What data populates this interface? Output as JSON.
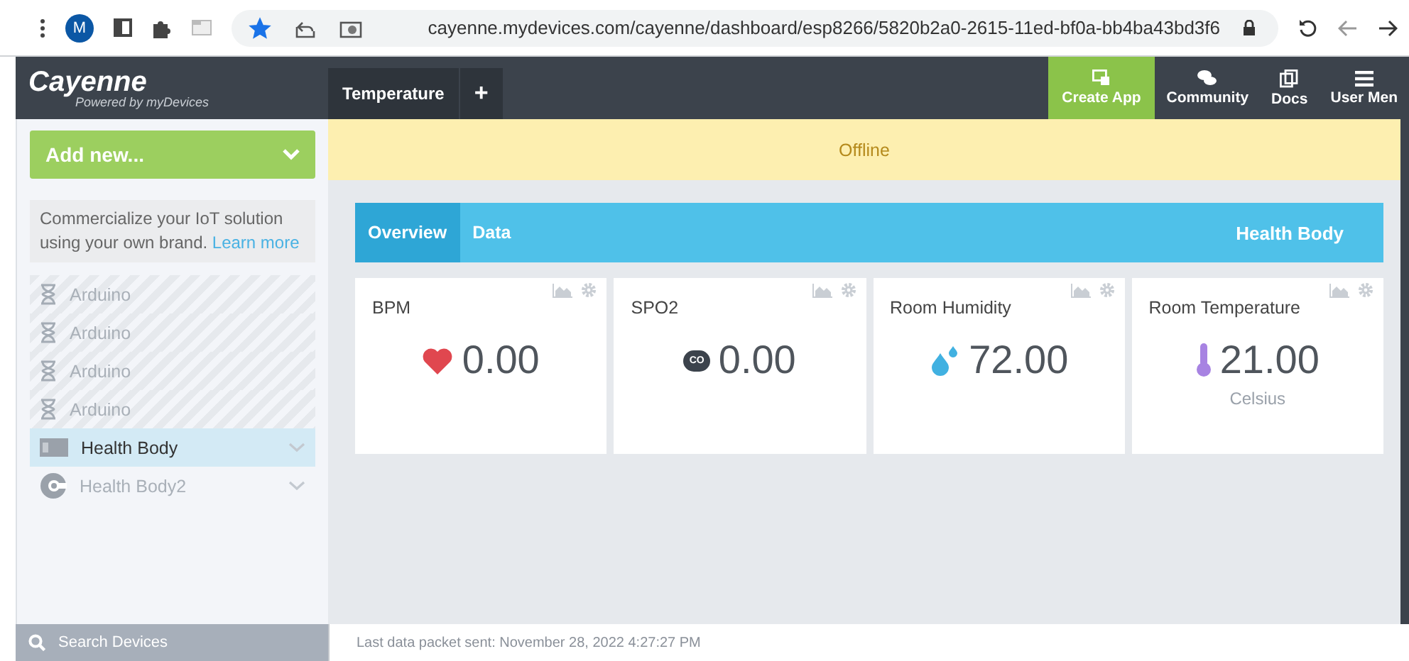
{
  "browser": {
    "avatar": "M",
    "bookmarked": true,
    "url": "cayenne.mydevices.com/cayenne/dashboard/esp8266/5820b2a0-2615-11ed-bf0a-bb4ba43bd3f6"
  },
  "header": {
    "logo": "Cayenne",
    "tagline": "Powered by myDevices",
    "tabs": [
      {
        "label": "Temperature",
        "selected": true
      }
    ],
    "add_tab": "+",
    "nav": [
      {
        "label": "Create App",
        "kind": "create",
        "selected": true
      },
      {
        "label": "Community",
        "kind": "community",
        "selected": false
      },
      {
        "label": "Docs",
        "kind": "docs",
        "selected": false
      },
      {
        "label": "User Men",
        "kind": "menu",
        "selected": false
      }
    ]
  },
  "sidebar": {
    "add_button": "Add new...",
    "promo": "Commercialize your IoT solution using your own brand. ",
    "promo_link": "Learn more",
    "devices": [
      {
        "name": "Arduino",
        "kind": "pending",
        "selected": false
      },
      {
        "name": "Arduino",
        "kind": "pending",
        "selected": false
      },
      {
        "name": "Arduino",
        "kind": "pending",
        "selected": false
      },
      {
        "name": "Arduino",
        "kind": "pending",
        "selected": false
      },
      {
        "name": "Health Body",
        "kind": "board",
        "selected": true
      },
      {
        "name": "Health Body2",
        "kind": "cayenne",
        "selected": false
      }
    ],
    "search": "Search Devices"
  },
  "banner": "Offline",
  "device_tabs": [
    {
      "label": "Overview",
      "selected": true
    },
    {
      "label": "Data",
      "selected": false
    }
  ],
  "device_name": "Health Body",
  "widgets": [
    {
      "title": "BPM",
      "kind": "heart",
      "value": "0.00"
    },
    {
      "title": "SPO2",
      "kind": "cloud",
      "badge": "CO",
      "value": "0.00"
    },
    {
      "title": "Room Humidity",
      "kind": "drop",
      "value": "72.00"
    },
    {
      "title": "Room Temperature",
      "kind": "thermometer",
      "value": "21.00",
      "unit": "Celsius"
    }
  ],
  "footer": "Last data packet sent: November 28, 2022 4:27:27 PM"
}
